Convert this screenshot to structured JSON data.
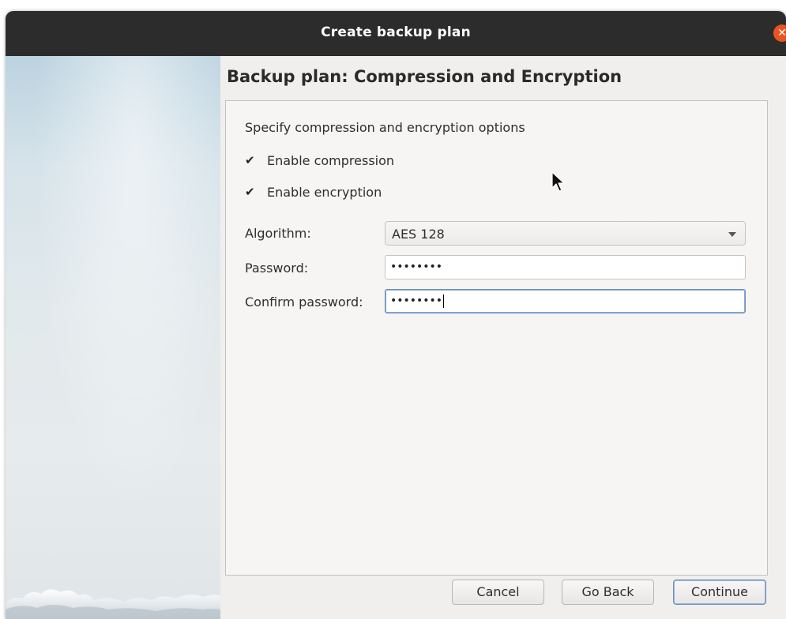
{
  "window": {
    "title": "Create backup plan",
    "close_icon": "close-icon",
    "accent": "#e95420"
  },
  "page": {
    "heading": "Backup plan: Compression and Encryption",
    "subtitle": "Specify compression and encryption options"
  },
  "options": {
    "compression_label": "Enable compression",
    "compression_checked": true,
    "encryption_label": "Enable encryption",
    "encryption_checked": true,
    "check_glyph": "✔"
  },
  "form": {
    "algorithm_label": "Algorithm:",
    "algorithm_value": "AES 128",
    "password_label": "Password:",
    "password_value": "••••••••",
    "confirm_label": "Confirm password:",
    "confirm_value": "••••••••"
  },
  "buttons": {
    "cancel": "Cancel",
    "go_back": "Go Back",
    "continue": "Continue"
  }
}
